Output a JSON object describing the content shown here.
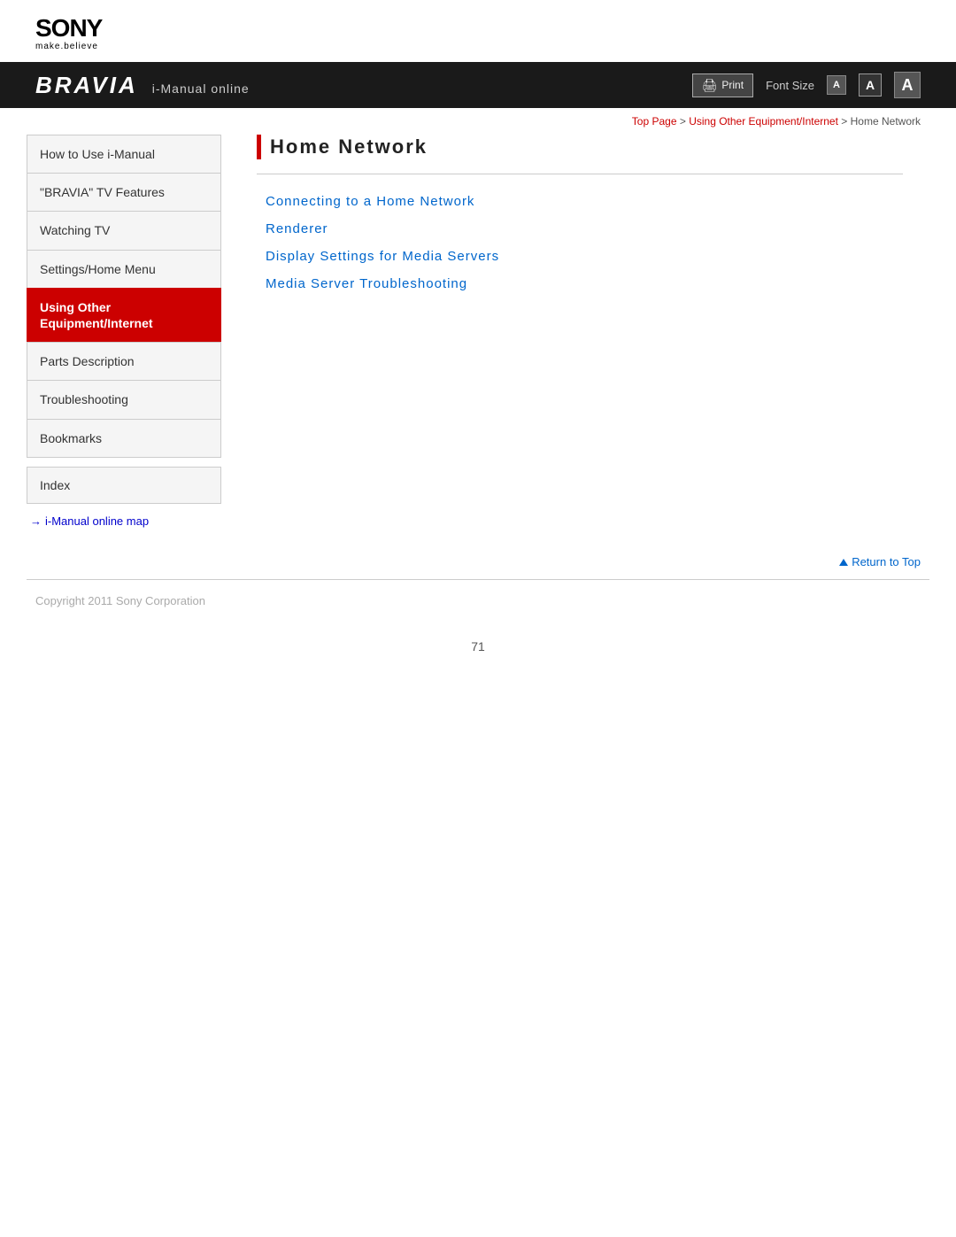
{
  "logo": {
    "sony": "SONY",
    "tagline": "make.believe"
  },
  "topbar": {
    "bravia": "BRAVIA",
    "manual": "i-Manual online",
    "print_label": "Print",
    "font_size_label": "Font Size",
    "font_small": "A",
    "font_medium": "A",
    "font_large": "A"
  },
  "breadcrumb": {
    "top_page": "Top Page",
    "separator1": " > ",
    "section": "Using Other Equipment/Internet",
    "separator2": " > ",
    "current": "Home Network"
  },
  "sidebar": {
    "items": [
      {
        "label": "How to Use i-Manual",
        "active": false
      },
      {
        "label": "\"BRAVIA\" TV Features",
        "active": false
      },
      {
        "label": "Watching TV",
        "active": false
      },
      {
        "label": "Settings/Home Menu",
        "active": false
      },
      {
        "label": "Using Other Equipment/Internet",
        "active": true
      },
      {
        "label": "Parts Description",
        "active": false
      },
      {
        "label": "Troubleshooting",
        "active": false
      },
      {
        "label": "Bookmarks",
        "active": false
      }
    ],
    "index_label": "Index",
    "map_link": "i-Manual online map"
  },
  "content": {
    "page_title": "Home Network",
    "links": [
      "Connecting to a Home Network",
      "Renderer",
      "Display Settings for Media Servers",
      "Media Server Troubleshooting"
    ]
  },
  "return_top": "Return to Top",
  "footer": {
    "copyright": "Copyright 2011 Sony Corporation"
  },
  "page_number": "71"
}
